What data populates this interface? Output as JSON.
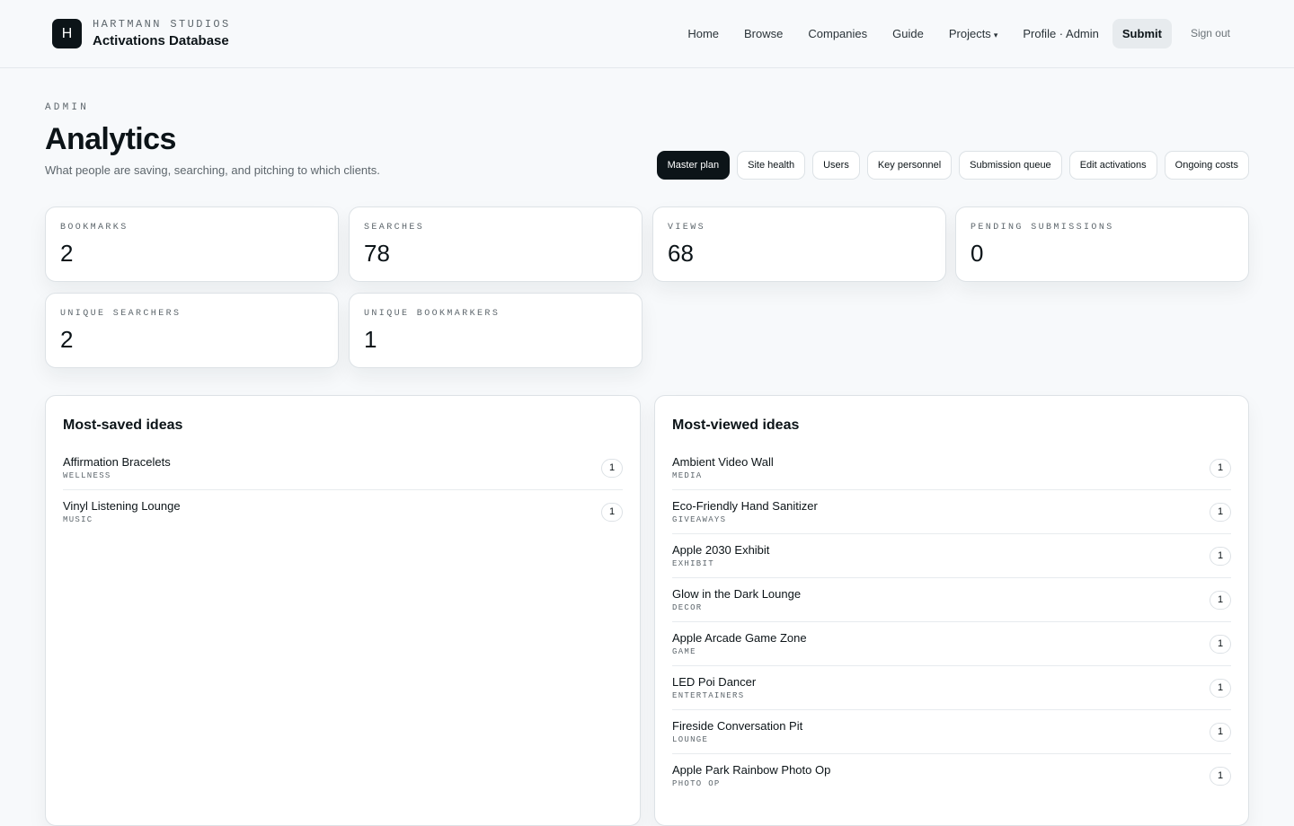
{
  "brand": {
    "logo_letter": "H",
    "company": "HARTMANN STUDIOS",
    "app_name": "Activations Database"
  },
  "nav": {
    "items": [
      {
        "label": "Home"
      },
      {
        "label": "Browse"
      },
      {
        "label": "Companies"
      },
      {
        "label": "Guide"
      },
      {
        "label": "Projects"
      },
      {
        "label": "Profile · Admin"
      },
      {
        "label": "Submit"
      },
      {
        "label": "Sign out"
      }
    ],
    "projects_caret": "▾"
  },
  "page": {
    "eyebrow": "ADMIN",
    "title": "Analytics",
    "subtitle": "What people are saving, searching, and pitching to which clients."
  },
  "tabs": [
    {
      "label": "Master plan",
      "active": true
    },
    {
      "label": "Site health"
    },
    {
      "label": "Users"
    },
    {
      "label": "Key personnel"
    },
    {
      "label": "Submission queue"
    },
    {
      "label": "Edit activations"
    },
    {
      "label": "Ongoing costs"
    }
  ],
  "stats": [
    {
      "label": "BOOKMARKS",
      "value": "2"
    },
    {
      "label": "SEARCHES",
      "value": "78"
    },
    {
      "label": "VIEWS",
      "value": "68"
    },
    {
      "label": "PENDING SUBMISSIONS",
      "value": "0"
    },
    {
      "label": "UNIQUE SEARCHERS",
      "value": "2"
    },
    {
      "label": "UNIQUE BOOKMARKERS",
      "value": "1"
    }
  ],
  "most_saved": {
    "title": "Most-saved ideas",
    "items": [
      {
        "name": "Affirmation Bracelets",
        "category": "WELLNESS",
        "count": "1"
      },
      {
        "name": "Vinyl Listening Lounge",
        "category": "MUSIC",
        "count": "1"
      }
    ]
  },
  "most_viewed": {
    "title": "Most-viewed ideas",
    "items": [
      {
        "name": "Ambient Video Wall",
        "category": "MEDIA",
        "count": "1"
      },
      {
        "name": "Eco-Friendly Hand Sanitizer",
        "category": "GIVEAWAYS",
        "count": "1"
      },
      {
        "name": "Apple 2030 Exhibit",
        "category": "EXHIBIT",
        "count": "1"
      },
      {
        "name": "Glow in the Dark Lounge",
        "category": "DECOR",
        "count": "1"
      },
      {
        "name": "Apple Arcade Game Zone",
        "category": "GAME",
        "count": "1"
      },
      {
        "name": "LED Poi Dancer",
        "category": "ENTERTAINERS",
        "count": "1"
      },
      {
        "name": "Fireside Conversation Pit",
        "category": "LOUNGE",
        "count": "1"
      },
      {
        "name": "Apple Park Rainbow Photo Op",
        "category": "PHOTO OP",
        "count": "1"
      }
    ]
  }
}
